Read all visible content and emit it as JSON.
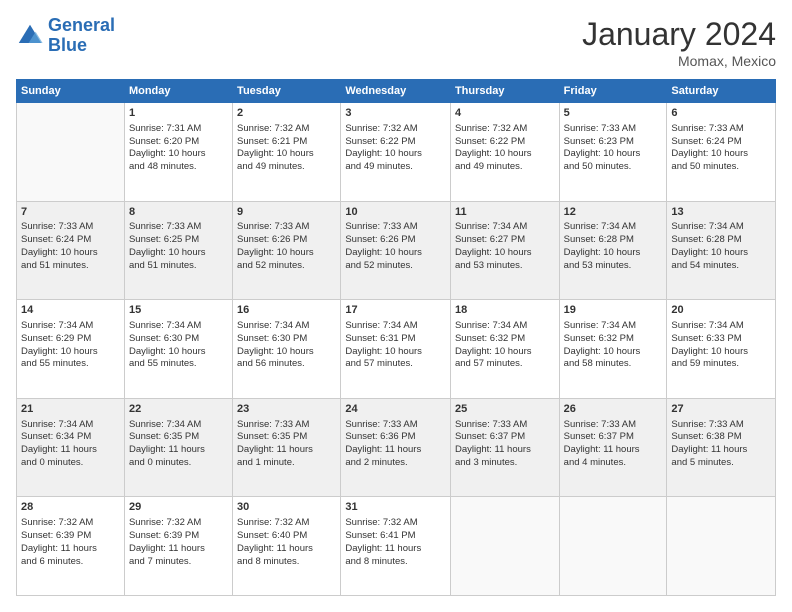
{
  "logo": {
    "text_general": "General",
    "text_blue": "Blue"
  },
  "header": {
    "title": "January 2024",
    "subtitle": "Momax, Mexico"
  },
  "columns": [
    "Sunday",
    "Monday",
    "Tuesday",
    "Wednesday",
    "Thursday",
    "Friday",
    "Saturday"
  ],
  "weeks": [
    {
      "shaded": false,
      "days": [
        {
          "date": "",
          "info": ""
        },
        {
          "date": "1",
          "info": "Sunrise: 7:31 AM\nSunset: 6:20 PM\nDaylight: 10 hours\nand 48 minutes."
        },
        {
          "date": "2",
          "info": "Sunrise: 7:32 AM\nSunset: 6:21 PM\nDaylight: 10 hours\nand 49 minutes."
        },
        {
          "date": "3",
          "info": "Sunrise: 7:32 AM\nSunset: 6:22 PM\nDaylight: 10 hours\nand 49 minutes."
        },
        {
          "date": "4",
          "info": "Sunrise: 7:32 AM\nSunset: 6:22 PM\nDaylight: 10 hours\nand 49 minutes."
        },
        {
          "date": "5",
          "info": "Sunrise: 7:33 AM\nSunset: 6:23 PM\nDaylight: 10 hours\nand 50 minutes."
        },
        {
          "date": "6",
          "info": "Sunrise: 7:33 AM\nSunset: 6:24 PM\nDaylight: 10 hours\nand 50 minutes."
        }
      ]
    },
    {
      "shaded": true,
      "days": [
        {
          "date": "7",
          "info": "Sunrise: 7:33 AM\nSunset: 6:24 PM\nDaylight: 10 hours\nand 51 minutes."
        },
        {
          "date": "8",
          "info": "Sunrise: 7:33 AM\nSunset: 6:25 PM\nDaylight: 10 hours\nand 51 minutes."
        },
        {
          "date": "9",
          "info": "Sunrise: 7:33 AM\nSunset: 6:26 PM\nDaylight: 10 hours\nand 52 minutes."
        },
        {
          "date": "10",
          "info": "Sunrise: 7:33 AM\nSunset: 6:26 PM\nDaylight: 10 hours\nand 52 minutes."
        },
        {
          "date": "11",
          "info": "Sunrise: 7:34 AM\nSunset: 6:27 PM\nDaylight: 10 hours\nand 53 minutes."
        },
        {
          "date": "12",
          "info": "Sunrise: 7:34 AM\nSunset: 6:28 PM\nDaylight: 10 hours\nand 53 minutes."
        },
        {
          "date": "13",
          "info": "Sunrise: 7:34 AM\nSunset: 6:28 PM\nDaylight: 10 hours\nand 54 minutes."
        }
      ]
    },
    {
      "shaded": false,
      "days": [
        {
          "date": "14",
          "info": "Sunrise: 7:34 AM\nSunset: 6:29 PM\nDaylight: 10 hours\nand 55 minutes."
        },
        {
          "date": "15",
          "info": "Sunrise: 7:34 AM\nSunset: 6:30 PM\nDaylight: 10 hours\nand 55 minutes."
        },
        {
          "date": "16",
          "info": "Sunrise: 7:34 AM\nSunset: 6:30 PM\nDaylight: 10 hours\nand 56 minutes."
        },
        {
          "date": "17",
          "info": "Sunrise: 7:34 AM\nSunset: 6:31 PM\nDaylight: 10 hours\nand 57 minutes."
        },
        {
          "date": "18",
          "info": "Sunrise: 7:34 AM\nSunset: 6:32 PM\nDaylight: 10 hours\nand 57 minutes."
        },
        {
          "date": "19",
          "info": "Sunrise: 7:34 AM\nSunset: 6:32 PM\nDaylight: 10 hours\nand 58 minutes."
        },
        {
          "date": "20",
          "info": "Sunrise: 7:34 AM\nSunset: 6:33 PM\nDaylight: 10 hours\nand 59 minutes."
        }
      ]
    },
    {
      "shaded": true,
      "days": [
        {
          "date": "21",
          "info": "Sunrise: 7:34 AM\nSunset: 6:34 PM\nDaylight: 11 hours\nand 0 minutes."
        },
        {
          "date": "22",
          "info": "Sunrise: 7:34 AM\nSunset: 6:35 PM\nDaylight: 11 hours\nand 0 minutes."
        },
        {
          "date": "23",
          "info": "Sunrise: 7:33 AM\nSunset: 6:35 PM\nDaylight: 11 hours\nand 1 minute."
        },
        {
          "date": "24",
          "info": "Sunrise: 7:33 AM\nSunset: 6:36 PM\nDaylight: 11 hours\nand 2 minutes."
        },
        {
          "date": "25",
          "info": "Sunrise: 7:33 AM\nSunset: 6:37 PM\nDaylight: 11 hours\nand 3 minutes."
        },
        {
          "date": "26",
          "info": "Sunrise: 7:33 AM\nSunset: 6:37 PM\nDaylight: 11 hours\nand 4 minutes."
        },
        {
          "date": "27",
          "info": "Sunrise: 7:33 AM\nSunset: 6:38 PM\nDaylight: 11 hours\nand 5 minutes."
        }
      ]
    },
    {
      "shaded": false,
      "days": [
        {
          "date": "28",
          "info": "Sunrise: 7:32 AM\nSunset: 6:39 PM\nDaylight: 11 hours\nand 6 minutes."
        },
        {
          "date": "29",
          "info": "Sunrise: 7:32 AM\nSunset: 6:39 PM\nDaylight: 11 hours\nand 7 minutes."
        },
        {
          "date": "30",
          "info": "Sunrise: 7:32 AM\nSunset: 6:40 PM\nDaylight: 11 hours\nand 8 minutes."
        },
        {
          "date": "31",
          "info": "Sunrise: 7:32 AM\nSunset: 6:41 PM\nDaylight: 11 hours\nand 8 minutes."
        },
        {
          "date": "",
          "info": ""
        },
        {
          "date": "",
          "info": ""
        },
        {
          "date": "",
          "info": ""
        }
      ]
    }
  ]
}
